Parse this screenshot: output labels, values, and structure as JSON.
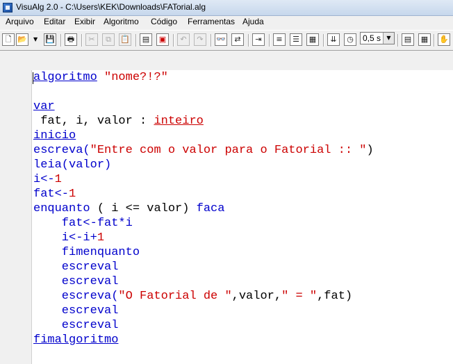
{
  "window": {
    "title": "VisuAlg 2.0 - C:\\Users\\KEK\\Downloads\\FATorial.alg"
  },
  "menu": [
    "Arquivo",
    "Editar",
    "Exibir",
    "Algoritmo",
    "Código",
    "Ferramentas",
    "Ajuda"
  ],
  "toolbar": {
    "speed_value": "0,5 s",
    "icons": [
      "new-file-icon",
      "open-folder-icon",
      "save-icon",
      "print-icon",
      "cut-icon",
      "copy-icon",
      "paste-icon",
      "copy-block-icon",
      "paste-block-icon",
      "undo-icon",
      "redo-icon",
      "find-binoculars-icon",
      "replace-icon",
      "indent-icon",
      "comment-icon",
      "uncomment-icon",
      "format-icon",
      "step-icon",
      "timer-icon",
      "hand-icon"
    ]
  },
  "editor": {
    "lines": [
      [
        "algoritmo",
        " ",
        "\"nome?!?\""
      ],
      [
        ""
      ],
      [
        "var"
      ],
      [
        " fat, i, valor : ",
        "inteiro"
      ],
      [
        "inicio"
      ],
      [
        "escreva(",
        "\"Entre com o valor para o Fatorial :: \"",
        ")"
      ],
      [
        "leia(valor)"
      ],
      [
        "i<-",
        "1"
      ],
      [
        "fat<-",
        "1"
      ],
      [
        "enquanto",
        " ( i <= valor) ",
        "faca"
      ],
      [
        "    fat<-fat*i"
      ],
      [
        "    i<-i+",
        "1"
      ],
      [
        "    fimenquanto"
      ],
      [
        "    escreval"
      ],
      [
        "    escreval"
      ],
      [
        "    escreva(",
        "\"O Fatorial de \"",
        ",valor,",
        "\" = \"",
        ",fat)"
      ],
      [
        "    escreval"
      ],
      [
        "    escreval"
      ],
      [
        "fimalgoritmo"
      ]
    ]
  }
}
